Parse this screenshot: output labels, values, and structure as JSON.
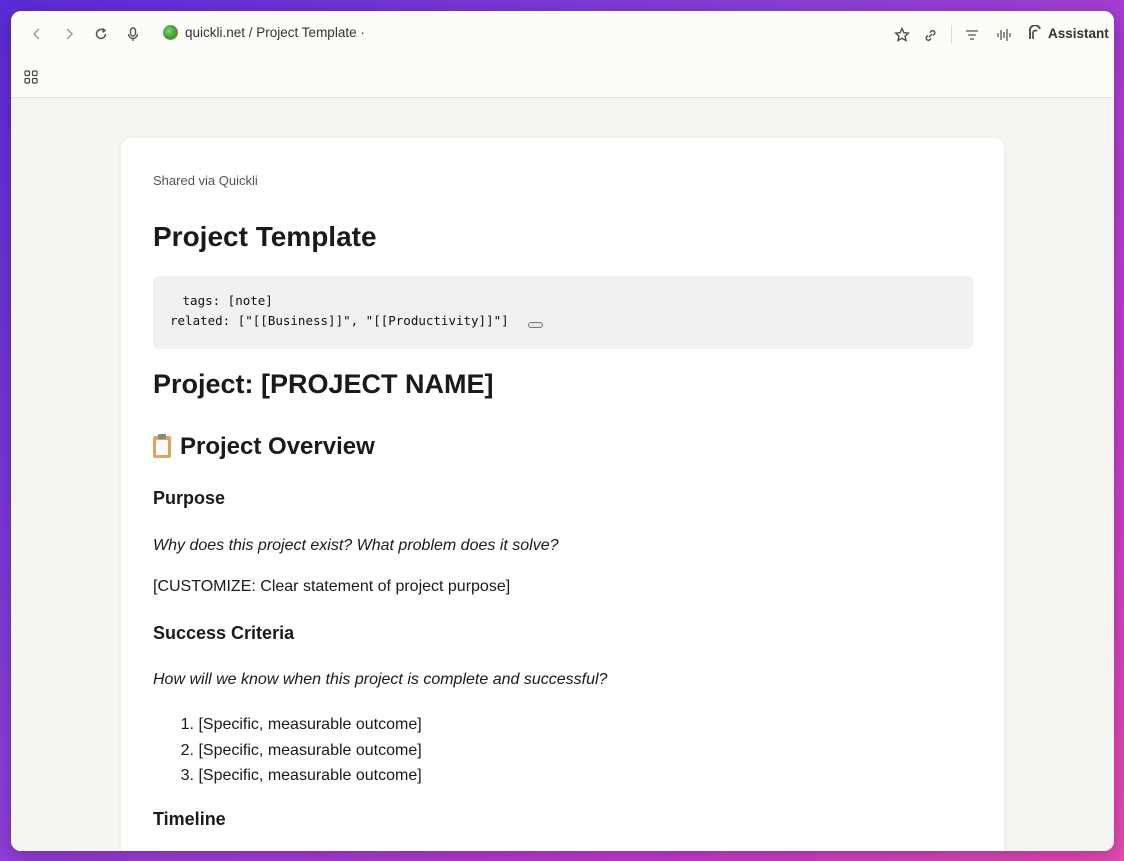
{
  "browser": {
    "url_text": "quickli.net / Project Template ·",
    "assistant_label": "Assistant"
  },
  "page": {
    "shared_label": "Shared via Quickli",
    "title": "Project Template",
    "frontmatter": {
      "line1": " tags: [note]",
      "line2": "related: [\"[[Business]]\", \"[[Productivity]]\"]"
    },
    "project_heading": "Project: [PROJECT NAME]",
    "overview_heading": "Project Overview",
    "purpose_heading": "Purpose",
    "purpose_prompt": "Why does this project exist? What problem does it solve?",
    "purpose_text": "[CUSTOMIZE: Clear statement of project purpose]",
    "success_heading": "Success Criteria",
    "success_prompt": "How will we know when this project is complete and successful?",
    "success_items": [
      {
        "num": "1.",
        "text": "[Specific, measurable outcome]"
      },
      {
        "num": "2.",
        "text": "[Specific, measurable outcome]"
      },
      {
        "num": "3.",
        "text": "[Specific, measurable outcome]"
      }
    ],
    "timeline_heading": "Timeline"
  }
}
